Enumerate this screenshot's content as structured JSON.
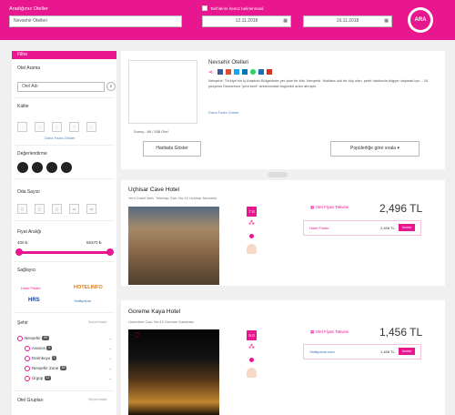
{
  "search": {
    "where_label": "Aradığınız Oteller",
    "where_value": "Nevsehir Otelleri",
    "dates_label": "Tarihlerim henüz belirlenmedi",
    "checkin": "12.11.2018",
    "checkout": "16.11.2018",
    "search_button": "ARA"
  },
  "filters": {
    "header": "Filtre",
    "hotel_search_label": "Otel Arama",
    "hotel_name_placeholder": "Otel Adı",
    "quality_label": "Kalite",
    "show_all": "Daha Fazla Göster",
    "ratings_label": "Değerlendirme",
    "rooms_label": "Oda Sayısı",
    "price_label": "Fiyat Aralığı",
    "price_min": "400 ₺",
    "price_max": "56370 ₺",
    "providers_label": "Sağlayıcı",
    "providers": [
      "Hotel Finder",
      "HOTELINFO",
      "HRS",
      "Yatiliyolum"
    ],
    "city_label": "Şehir",
    "city_more": "Seçimi Kaldır",
    "cities": [
      {
        "name": "Nevşehir",
        "count": "99"
      },
      {
        "name": "Avanos",
        "count": "4"
      },
      {
        "name": "Derinkuyu",
        "count": "1"
      },
      {
        "name": "Nevşehir Zone",
        "count": "38"
      },
      {
        "name": "Ürgüp",
        "count": "12"
      }
    ],
    "hotel_groups_label": "Otel Grupları",
    "hotel_groups_more": "Seçimi Kaldır"
  },
  "info": {
    "title": "Nevsehir Otelleri",
    "description": "Nevşehir, Türkiye'nin İç Anadolu Bölgesinde yer alan bir ildir. Nevşehir, Mutlaka ulık bir köy olan, şehir hakkında bilgiye ulaşmak için... 18 yüzyılda Osmanlıca \"yeni kent\" anlamındaki bugünkü adını almıştır.",
    "more_link": "Daha Fazla Göster",
    "counter": "Sonuç : 66 / 538 Otel",
    "map_button": "Haritada Göster",
    "sort_value": "Popülerliğe göre sırala"
  },
  "hotels": [
    {
      "name": "Uçhisar Cave Hotel",
      "address": "Yeni Camii Mah. Tekirtaşı Sok. No:10 Uçhisar Nevsehir",
      "rating": "7.8",
      "offer_label": "Otel Fiyatı Takvimi",
      "price": "2,496 TL",
      "provider": "Hotel Finder",
      "provider_price": "2,496 TL",
      "select": "İncele"
    },
    {
      "name": "Goreme Kaya Hotel",
      "address": "Uzundere Cad. No:43 Goreme Kasabası",
      "rating": "9.0",
      "offer_label": "Otel Fiyatı Takvimi",
      "price": "1,456 TL",
      "provider": "Yatiliyolum.com",
      "provider_price": "1,456 TL",
      "select": "İncele"
    }
  ],
  "colors": {
    "accent": "#e8168f"
  }
}
